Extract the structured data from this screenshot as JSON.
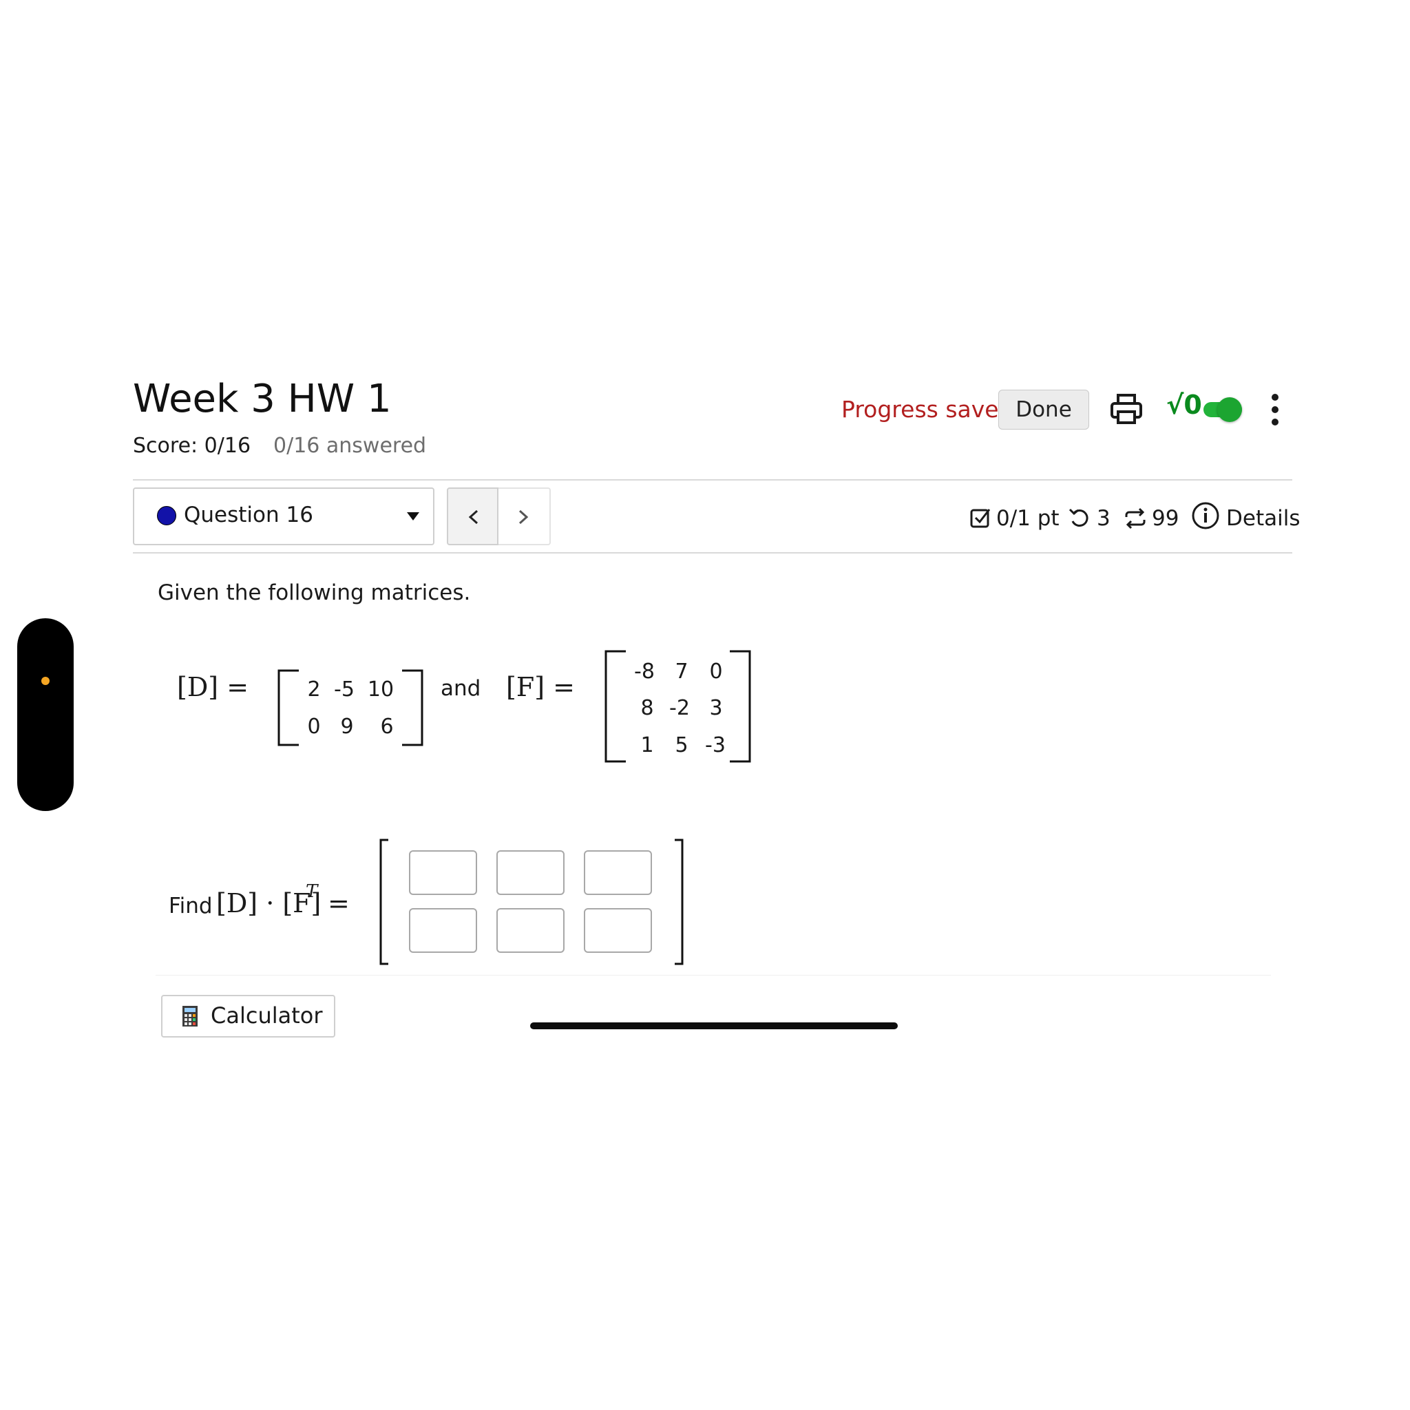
{
  "header": {
    "title": "Week 3 HW 1",
    "score": "Score: 0/16",
    "answered": "0/16 answered",
    "progress_status": "Progress saved",
    "done_label": "Done",
    "sqrt_label": "√0"
  },
  "question_bar": {
    "selected_question": "Question 16",
    "points": "0/1 pt",
    "retries": "3",
    "attempts": "99",
    "details_label": "Details"
  },
  "problem": {
    "prompt": "Given the following matrices.",
    "matrix_d_label": "[D] =",
    "matrix_d": [
      [
        "2",
        "-5",
        "10"
      ],
      [
        "0",
        "9",
        "6"
      ]
    ],
    "connector": "and",
    "matrix_f_label": "[F] =",
    "matrix_f": [
      [
        "-8",
        "7",
        "0"
      ],
      [
        "8",
        "-2",
        "3"
      ],
      [
        "1",
        "5",
        "-3"
      ]
    ],
    "find_label": "Find",
    "find_expression": "[D] · [F]",
    "find_superscript": "T",
    "equals": "=",
    "answer_grid": [
      [
        "",
        "",
        ""
      ],
      [
        "",
        "",
        ""
      ]
    ]
  },
  "tools": {
    "calculator_label": "Calculator"
  },
  "colors": {
    "progress_red": "#b21f1f",
    "toggle_green": "#1ca531",
    "question_dot": "#1212a8",
    "side_dot": "#f5a623"
  },
  "icons": [
    "print-icon",
    "sqrt-toggle-icon",
    "kebab-menu-icon",
    "chevron-left-icon",
    "chevron-right-icon",
    "checkbox-icon",
    "retry-icon",
    "repeat-icon",
    "info-icon",
    "calculator-icon"
  ]
}
